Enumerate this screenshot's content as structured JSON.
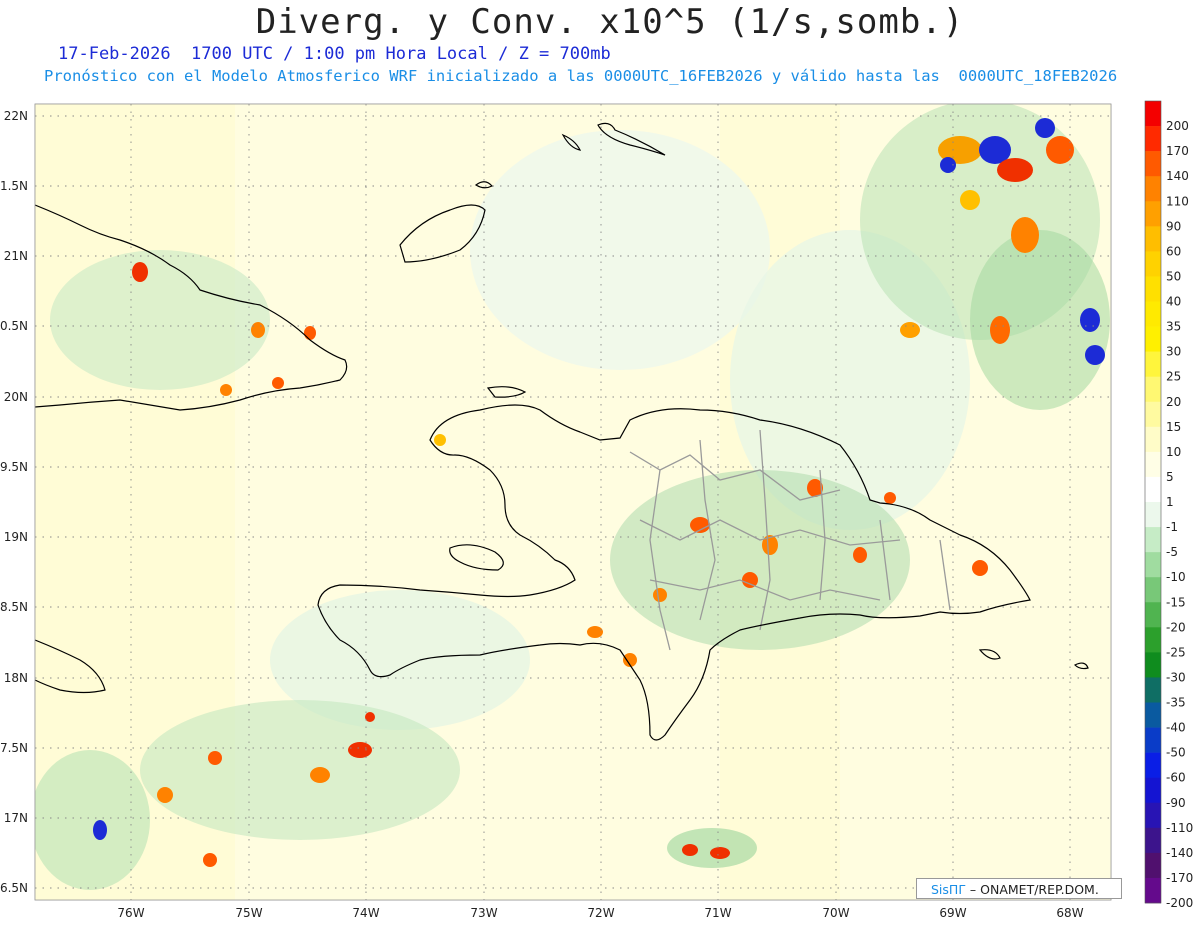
{
  "header": {
    "title": "Diverg. y Conv. x10^5 (1/s,somb.)",
    "subtitle_line1": "17-Feb-2026  1700 UTC / 1:00 pm Hora Local / Z = 700mb",
    "subtitle_line2": "Pronóstico con el Modelo Atmosferico WRF inicializado a las 0000UTC_16FEB2026 y válido hasta las  0000UTC_18FEB2026"
  },
  "axes": {
    "lat_labels": [
      "22N",
      "1.5N",
      "21N",
      "0.5N",
      "20N",
      "9.5N",
      "19N",
      "8.5N",
      "18N",
      "7.5N",
      "17N",
      "6.5N"
    ],
    "lon_labels": [
      "76W",
      "75W",
      "74W",
      "73W",
      "72W",
      "71W",
      "70W",
      "69W",
      "68W"
    ]
  },
  "colorbar": {
    "labels": [
      "200",
      "170",
      "140",
      "110",
      "90",
      "60",
      "50",
      "40",
      "35",
      "30",
      "25",
      "20",
      "15",
      "10",
      "5",
      "1",
      "-1",
      "-5",
      "-10",
      "-15",
      "-20",
      "-25",
      "-30",
      "-35",
      "-40",
      "-50",
      "-60",
      "-90",
      "-110",
      "-140",
      "-170",
      "-200"
    ],
    "colors": [
      "#f40000",
      "#ff2a00",
      "#ff5a00",
      "#ff8200",
      "#ffa000",
      "#ffbe00",
      "#ffd200",
      "#ffe000",
      "#ffea00",
      "#fff000",
      "#fff53c",
      "#fff872",
      "#fffaa0",
      "#fffcc8",
      "#fffee6",
      "#ffffff",
      "#ecf8ec",
      "#c6ecc6",
      "#a0dca0",
      "#78c878",
      "#50b450",
      "#2ca02c",
      "#0f8c1e",
      "#0f6e64",
      "#0a5aa0",
      "#0a3cc8",
      "#0a1ee6",
      "#1414d2",
      "#2814b4",
      "#3c148c",
      "#50106e",
      "#640a8c"
    ]
  },
  "credit": {
    "brand": "SisПГ",
    "text": " – ONAMET/REP.DOM."
  }
}
